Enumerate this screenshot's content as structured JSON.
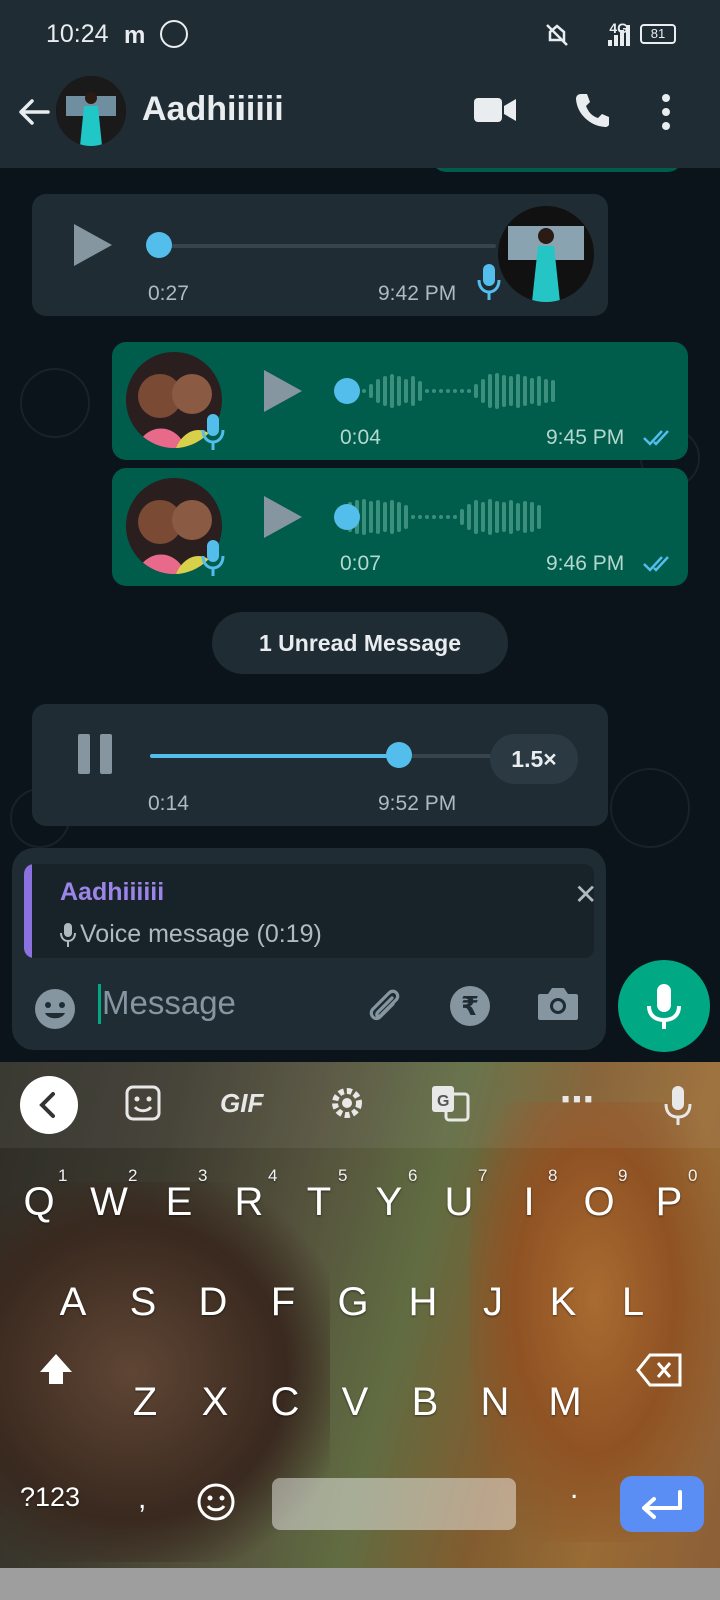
{
  "status_bar": {
    "time": "10:24",
    "apps": "m",
    "network": "4G",
    "battery": "81"
  },
  "header": {
    "contact_name": "Aadhiiiiii"
  },
  "messages": [
    {
      "direction": "in",
      "duration": "0:27",
      "time": "9:42 PM",
      "progress": 0.0
    },
    {
      "direction": "out",
      "duration": "0:04",
      "time": "9:45 PM",
      "status": "read"
    },
    {
      "direction": "out",
      "duration": "0:07",
      "time": "9:46 PM",
      "status": "read"
    },
    {
      "direction": "in",
      "duration": "0:14",
      "time": "9:52 PM",
      "progress": 0.72,
      "playing": true,
      "speed": "1.5×"
    }
  ],
  "unread_label": "1 Unread Message",
  "reply": {
    "name": "Aadhiiiiii",
    "text": "Voice message (0:19)"
  },
  "composer": {
    "placeholder": "Message"
  },
  "keyboard": {
    "gif_label": "GIF",
    "row1": [
      "Q",
      "W",
      "E",
      "R",
      "T",
      "Y",
      "U",
      "I",
      "O",
      "P"
    ],
    "row1_hints": [
      "1",
      "2",
      "3",
      "4",
      "5",
      "6",
      "7",
      "8",
      "9",
      "0"
    ],
    "row2": [
      "A",
      "S",
      "D",
      "F",
      "G",
      "H",
      "J",
      "K",
      "L"
    ],
    "row3": [
      "Z",
      "X",
      "C",
      "V",
      "B",
      "N",
      "M"
    ],
    "symbols_label": "?123",
    "comma": ",",
    "period": "."
  },
  "colors": {
    "header": "#1f2c34",
    "outgoing": "#005c4b",
    "incoming": "#1f2c34",
    "accent": "#00a884",
    "audio": "#53bdeb"
  }
}
